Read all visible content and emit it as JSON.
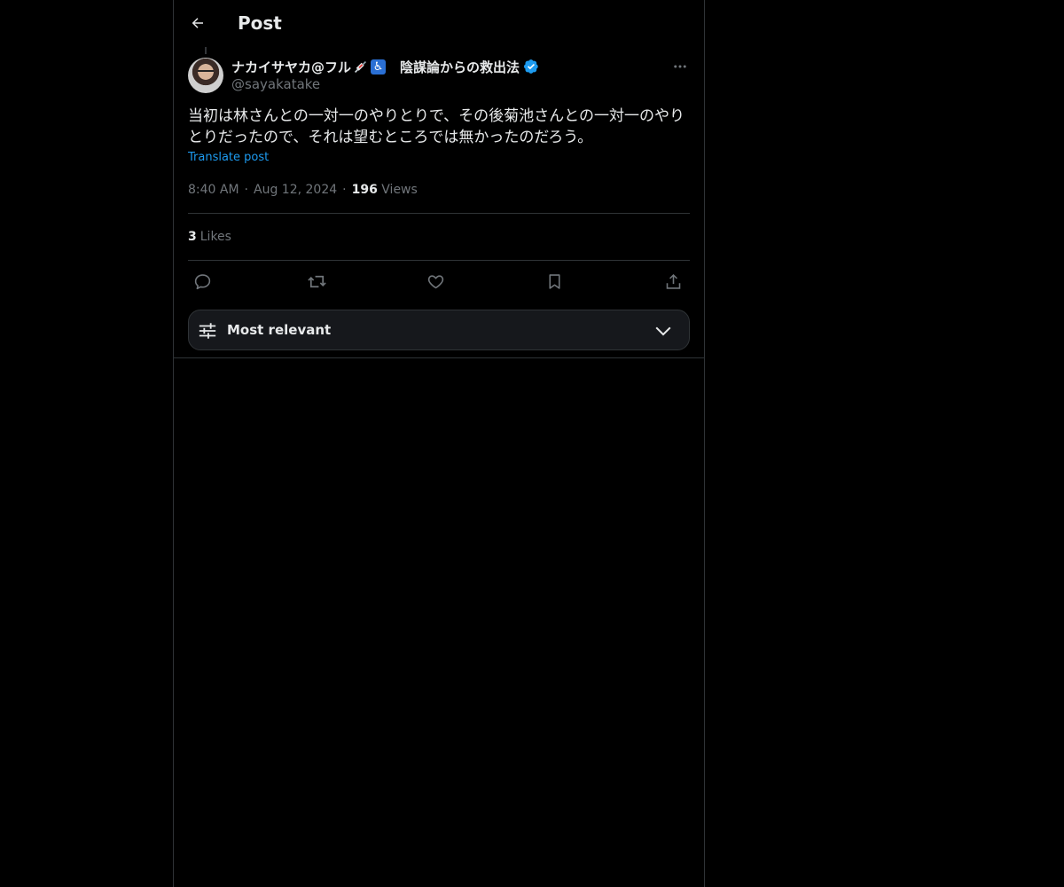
{
  "header": {
    "title": "Post",
    "back_icon": "arrow-left-icon"
  },
  "author": {
    "display_name": "ナカイサヤカ@フル",
    "emojis": [
      "syringe-emoji",
      "wheelchair-emoji"
    ],
    "name_suffix": "陰謀論からの救出法",
    "verified": true,
    "handle": "@sayakatake"
  },
  "post": {
    "text": "当初は林さんとの一対一のやりとりで、その後菊池さんとの一対一のやりとりだったので、それは望むところでは無かったのだろう。",
    "translate_label": "Translate post",
    "time": "8:40 AM",
    "date": "Aug 12, 2024",
    "views_count": "196",
    "views_label": "Views",
    "likes_count": "3",
    "likes_label": "Likes"
  },
  "actions": [
    "reply-icon",
    "repost-icon",
    "like-icon",
    "bookmark-icon",
    "share-icon"
  ],
  "sort": {
    "label": "Most relevant"
  },
  "colors": {
    "background": "#000000",
    "text": "#e7e9ea",
    "secondary": "#71767b",
    "accent": "#1d9bf0",
    "border": "#2f3336"
  }
}
